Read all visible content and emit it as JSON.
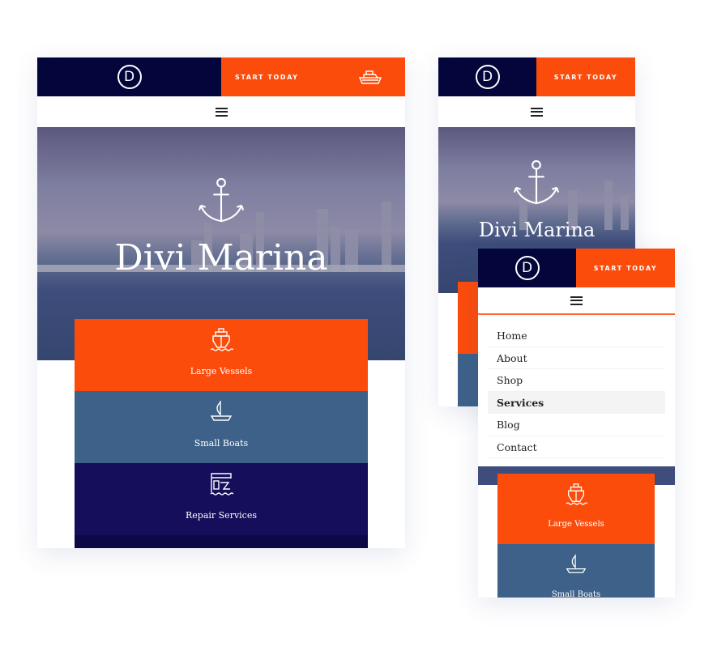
{
  "brand": {
    "logo_letter": "D",
    "cta_label": "START TODAY",
    "colors": {
      "navy": "#03053b",
      "orange": "#fc4c0c",
      "steel_blue": "#3d6189",
      "deep_navy": "#150e5a"
    }
  },
  "hero": {
    "title": "Divi Marina",
    "icon": "anchor-icon"
  },
  "services": [
    {
      "label": "Large Vessels",
      "icon": "ship-icon"
    },
    {
      "label": "Small Boats",
      "icon": "sailboat-icon"
    },
    {
      "label": "Repair Services",
      "icon": "crane-dock-icon"
    }
  ],
  "menu": {
    "items": [
      {
        "label": "Home"
      },
      {
        "label": "About"
      },
      {
        "label": "Shop"
      },
      {
        "label": "Services",
        "active": true
      },
      {
        "label": "Blog"
      },
      {
        "label": "Contact"
      }
    ]
  }
}
